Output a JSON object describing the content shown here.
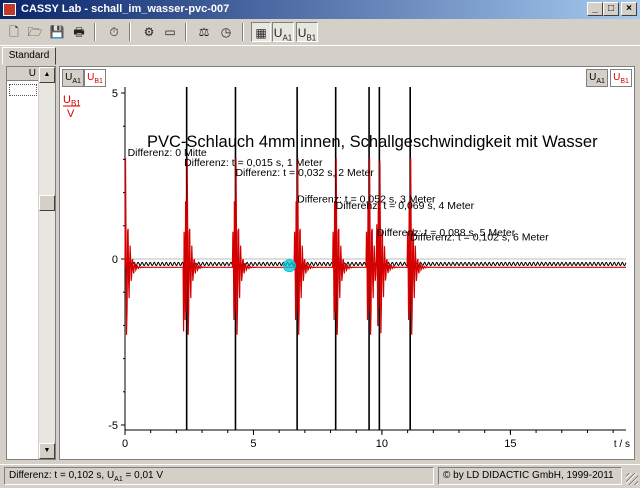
{
  "window": {
    "title": "CASSY Lab - schall_im_wasser-pvc-007",
    "controls": [
      "_",
      "□",
      "×"
    ]
  },
  "toolbar": {
    "items": [
      {
        "name": "new-icon",
        "glyph": "🗋"
      },
      {
        "name": "open-icon",
        "glyph": "🗁"
      },
      {
        "name": "save-icon",
        "glyph": "💾"
      },
      {
        "name": "print-icon",
        "glyph": "🖶"
      },
      {
        "name": "stopwatch-icon",
        "glyph": "⏱"
      },
      {
        "name": "hardware-icon",
        "glyph": "⚙"
      },
      {
        "name": "display-icon",
        "glyph": "▭"
      },
      {
        "name": "parameters-icon",
        "glyph": "⚖"
      },
      {
        "name": "start-measurement-icon",
        "glyph": "◷"
      },
      {
        "name": "window-icon",
        "glyph": "▦"
      }
    ],
    "channel_ua1": {
      "main": "U",
      "sub": "A1"
    },
    "channel_ub1": {
      "main": "U",
      "sub": "B1"
    }
  },
  "tabs": {
    "active": "Standard"
  },
  "left_panel": {
    "column_header": "U"
  },
  "plot": {
    "channel_ua1": {
      "main": "U",
      "sub": "A1"
    },
    "channel_ub1": {
      "main": "U",
      "sub": "B1"
    },
    "y_axis": {
      "name": "U",
      "sub": "B1",
      "unit": "V"
    },
    "x_unit_label": "t / s",
    "colors": {
      "ub1": "#d40000",
      "ua1": "#000000",
      "marker": "#00c8d8"
    }
  },
  "chart_data": {
    "type": "line",
    "title": "PVC-Schlauch 4mm innen, Schallgeschwindigkeit mit Wasser",
    "xlabel": "t / s",
    "ylabel": "U B1 / V",
    "xlim": [
      0,
      19.5
    ],
    "ylim": [
      -5,
      5
    ],
    "x_ticks": [
      0,
      5,
      10,
      15
    ],
    "y_ticks": [
      5,
      0,
      -5
    ],
    "pulse_times": [
      0,
      2.4,
      4.3,
      6.7,
      8.2,
      9.5,
      9.9,
      11.1
    ],
    "vertical_markers": [
      2.4,
      4.3,
      6.7,
      8.2,
      9.5,
      9.9,
      11.1
    ],
    "marker_point": {
      "x": 6.4,
      "y": -0.2
    },
    "series": [
      {
        "name": "U B1",
        "color": "#d40000",
        "baseline": -0.25,
        "pulse_amplitude": 4
      },
      {
        "name": "U A1",
        "color": "#000000",
        "baseline": -0.15,
        "pulse_amplitude": 0.3
      }
    ],
    "annotations": [
      {
        "x": 0.1,
        "y": 3.1,
        "text": "Differenz: 0 Mitte"
      },
      {
        "x": 2.3,
        "y": 2.8,
        "text": "Differenz: t =  0,015 s,  1 Meter"
      },
      {
        "x": 4.3,
        "y": 2.5,
        "text": "Differenz: t =  0,032 s,   2 Meter"
      },
      {
        "x": 6.7,
        "y": 1.7,
        "text": "Differenz: t =  0,052 s,  3 Meter"
      },
      {
        "x": 8.2,
        "y": 1.5,
        "text": "Differenz: t =  0,069 s,   4 Meter"
      },
      {
        "x": 9.8,
        "y": 0.7,
        "text": "Differenz: t =  0,088 s,   5 Meter"
      },
      {
        "x": 11.1,
        "y": 0.55,
        "text": "Differenz: t =  0,102 s,   6 Meter"
      }
    ]
  },
  "status": {
    "left_prefix": "Differenz:  t = 0,102 s,  ",
    "left_sym": "U",
    "left_sub": "A1",
    "left_suffix": " = 0,01 V",
    "right": "© by LD DIDACTIC GmbH, 1999-2011"
  }
}
